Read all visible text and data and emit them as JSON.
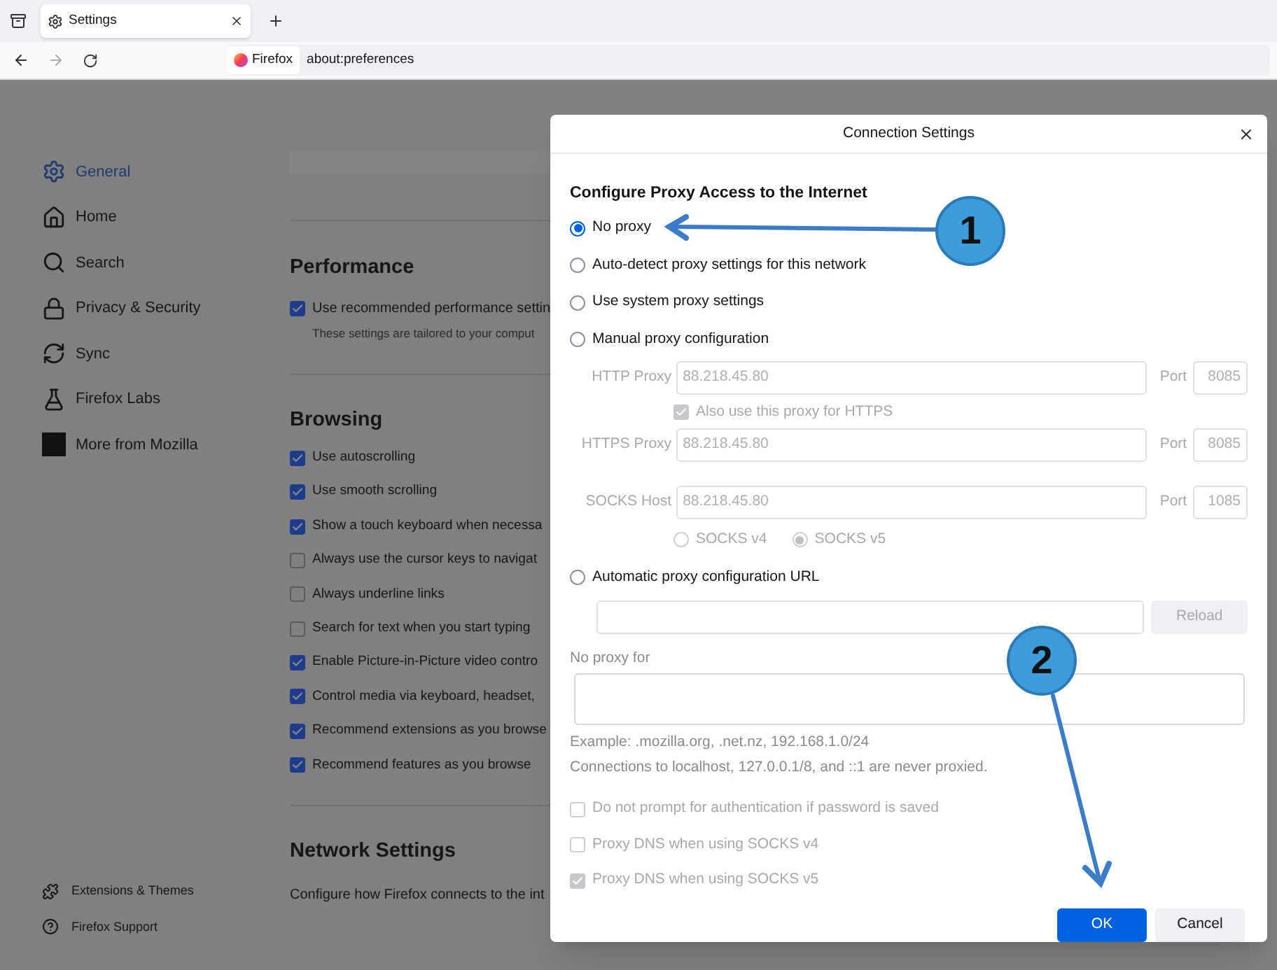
{
  "browser": {
    "tab_title": "Settings",
    "identity_label": "Firefox",
    "url": "about:preferences"
  },
  "sidebar": {
    "items": [
      {
        "label": "General",
        "selected": true
      },
      {
        "label": "Home",
        "selected": false
      },
      {
        "label": "Search",
        "selected": false
      },
      {
        "label": "Privacy & Security",
        "selected": false
      },
      {
        "label": "Sync",
        "selected": false
      },
      {
        "label": "Firefox Labs",
        "selected": false
      },
      {
        "label": "More from Mozilla",
        "selected": false
      }
    ],
    "footer_items": [
      {
        "label": "Extensions & Themes"
      },
      {
        "label": "Firefox Support"
      }
    ]
  },
  "performance": {
    "heading": "Performance",
    "items": [
      {
        "label": "Use recommended performance settin",
        "checked": true,
        "note": "These settings are tailored to your comput"
      }
    ]
  },
  "browsing": {
    "heading": "Browsing",
    "items": [
      {
        "label": "Use autoscrolling",
        "checked": true
      },
      {
        "label": "Use smooth scrolling",
        "checked": true
      },
      {
        "label": "Show a touch keyboard when necessa",
        "checked": true
      },
      {
        "label": "Always use the cursor keys to navigat",
        "checked": false
      },
      {
        "label": "Always underline links",
        "checked": false
      },
      {
        "label": "Search for text when you start typing",
        "checked": false
      },
      {
        "label": "Enable Picture-in-Picture video contro",
        "checked": true
      },
      {
        "label": "Control media via keyboard, headset,",
        "checked": true
      },
      {
        "label": "Recommend extensions as you browse",
        "checked": true
      },
      {
        "label": "Recommend features as you browse",
        "checked": true
      }
    ]
  },
  "network": {
    "heading": "Network Settings",
    "text": "Configure how Firefox connects to the int"
  },
  "dialog": {
    "title": "Connection Settings",
    "heading": "Configure Proxy Access to the Internet",
    "options": [
      {
        "label": "No proxy",
        "selected": true
      },
      {
        "label": "Auto-detect proxy settings for this network",
        "selected": false
      },
      {
        "label": "Use system proxy settings",
        "selected": false
      },
      {
        "label": "Manual proxy configuration",
        "selected": false
      },
      {
        "label": "Automatic proxy configuration URL",
        "selected": false
      }
    ],
    "manual": {
      "disabled": true,
      "rows": [
        {
          "label": "HTTP Proxy",
          "value": "88.218.45.80",
          "port_label": "Port",
          "port": "8085"
        },
        {
          "label": "HTTPS Proxy",
          "value": "88.218.45.80",
          "port_label": "Port",
          "port": "8085"
        },
        {
          "label": "SOCKS Host",
          "value": "88.218.45.80",
          "port_label": "Port",
          "port": "1085"
        }
      ],
      "also_https": {
        "label": "Also use this proxy for HTTPS",
        "checked": true
      },
      "socks_versions": [
        {
          "label": "SOCKS v4",
          "selected": false
        },
        {
          "label": "SOCKS v5",
          "selected": true
        }
      ]
    },
    "auto_url": {
      "disabled": true,
      "reload": "Reload"
    },
    "no_proxy_label": "No proxy for",
    "example": "Example: .mozilla.org, .net.nz, 192.168.1.0/24",
    "localhost_note": "Connections to localhost, 127.0.0.1/8, and ::1 are never proxied.",
    "checks": [
      {
        "label": "Do not prompt for authentication if password is saved",
        "checked": false,
        "disabled": true
      },
      {
        "label": "Proxy DNS when using SOCKS v4",
        "checked": false,
        "disabled": true
      },
      {
        "label": "Proxy DNS when using SOCKS v5",
        "checked": true,
        "disabled": true
      }
    ],
    "ok": "OK",
    "cancel": "Cancel"
  },
  "annotations": [
    {
      "label": "1"
    },
    {
      "label": "2"
    }
  ]
}
